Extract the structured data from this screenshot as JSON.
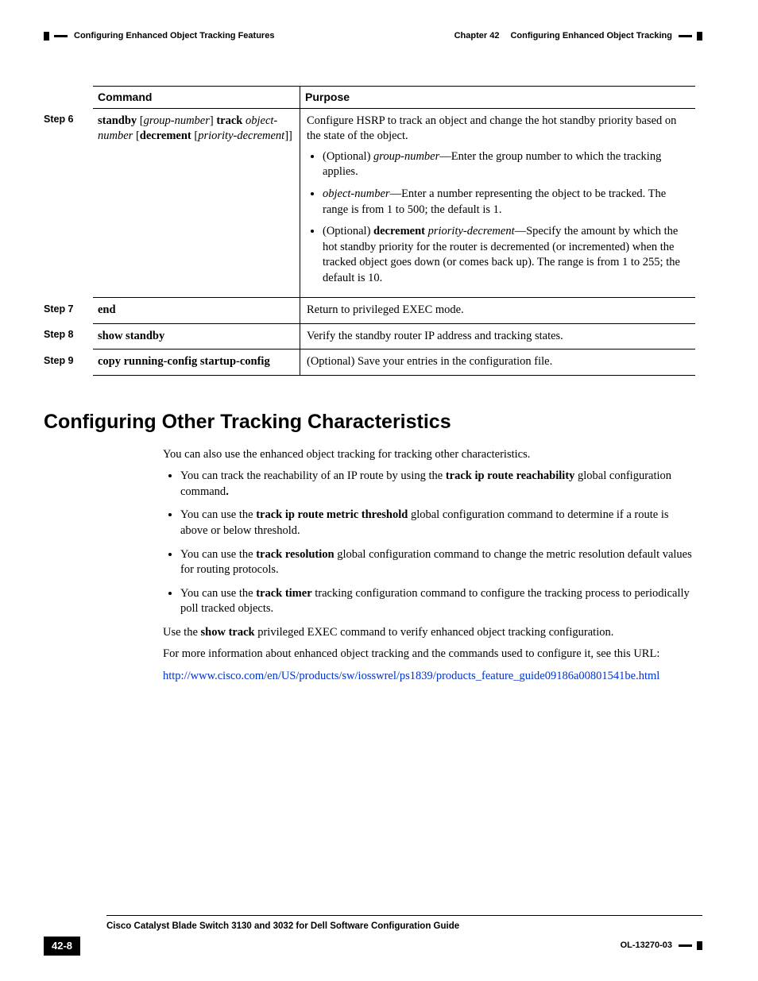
{
  "header": {
    "left": "Configuring Enhanced Object Tracking Features",
    "right_prefix": "Chapter 42",
    "right_title": "Configuring Enhanced Object Tracking"
  },
  "table": {
    "col_command": "Command",
    "col_purpose": "Purpose",
    "rows": {
      "r6": {
        "step": "Step 6",
        "cmd_a": "standby",
        "cmd_b": "group-number",
        "cmd_c": "track",
        "cmd_d": "object-number",
        "cmd_e": "decrement",
        "cmd_f": "priority-decrement",
        "purpose_intro": "Configure HSRP to track an object and change the hot standby priority based on the state of the object.",
        "b1_a": "(Optional) ",
        "b1_b": "group-number",
        "b1_c": "—Enter the group number to which the tracking applies.",
        "b2_a": "object-number",
        "b2_b": "—Enter a number representing the object to be tracked. The range is from 1 to 500; the default is 1.",
        "b3_a": "(Optional) ",
        "b3_b": "decrement",
        "b3_c": "priority-decrement",
        "b3_d": "—Specify the amount by which the hot standby priority for the router is decremented (or incremented) when the tracked object goes down (or comes back up). The range is from 1 to 255; the default is 10."
      },
      "r7": {
        "step": "Step 7",
        "cmd": "end",
        "purpose": "Return to privileged EXEC mode."
      },
      "r8": {
        "step": "Step 8",
        "cmd": "show standby",
        "purpose": "Verify the standby router IP address and tracking states."
      },
      "r9": {
        "step": "Step 9",
        "cmd": "copy running-config startup-config",
        "purpose": "(Optional) Save your entries in the configuration file."
      }
    }
  },
  "section": {
    "heading": "Configuring Other Tracking Characteristics",
    "p1": "You can also use the enhanced object tracking for tracking other characteristics.",
    "l1_a": "You can track the reachability of an IP route by using the ",
    "l1_b": "track ip route reachability",
    "l1_c": " global configuration command",
    "l1_d": ".",
    "l2_a": "You can use the ",
    "l2_b": "track ip route metric threshold",
    "l2_c": " global configuration command to determine if a route is above or below threshold.",
    "l3_a": "You can use the ",
    "l3_b": "track resolution",
    "l3_c": " global configuration command to change the metric resolution default values for routing protocols.",
    "l4_a": "You can use the ",
    "l4_b": "track timer",
    "l4_c": " tracking configuration command to configure the tracking process to periodically poll tracked objects.",
    "p2_a": "Use the ",
    "p2_b": "show track",
    "p2_c": " privileged EXEC command to verify enhanced object tracking configuration.",
    "p3": "For more information about enhanced object tracking and the commands used to configure it, see this URL:",
    "link": "http://www.cisco.com/en/US/products/sw/iosswrel/ps1839/products_feature_guide09186a00801541be.html"
  },
  "footer": {
    "book": "Cisco Catalyst Blade Switch 3130 and 3032 for Dell Software Configuration Guide",
    "page": "42-8",
    "docid": "OL-13270-03"
  }
}
